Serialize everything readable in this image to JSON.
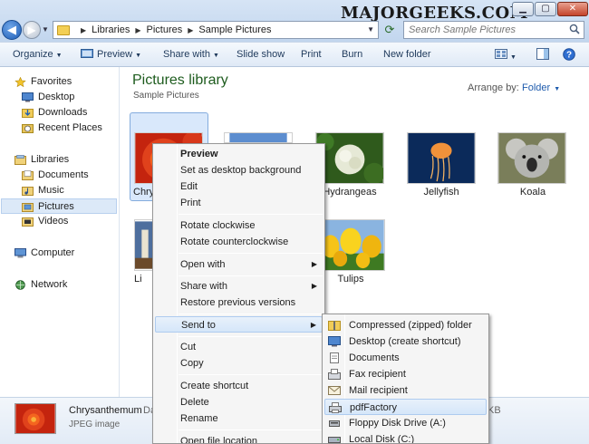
{
  "watermark": "MAJORGEEKS.COM",
  "address": {
    "crumbs": [
      "Libraries",
      "Pictures",
      "Sample Pictures"
    ]
  },
  "search": {
    "placeholder": "Search Sample Pictures"
  },
  "toolbar": {
    "organize": "Organize",
    "preview": "Preview",
    "share_with": "Share with",
    "slide_show": "Slide show",
    "print": "Print",
    "burn": "Burn",
    "new_folder": "New folder"
  },
  "sidebar": {
    "favorites": "Favorites",
    "desktop": "Desktop",
    "downloads": "Downloads",
    "recent_places": "Recent Places",
    "libraries": "Libraries",
    "documents": "Documents",
    "music": "Music",
    "pictures": "Pictures",
    "videos": "Videos",
    "computer": "Computer",
    "network": "Network"
  },
  "main": {
    "title": "Pictures library",
    "subtitle": "Sample Pictures",
    "arrange_label": "Arrange by:",
    "arrange_value": "Folder",
    "files": {
      "chrysanthemum_partial": "Chry",
      "hydrangeas": "Hydrangeas",
      "jellyfish": "Jellyfish",
      "koala": "Koala",
      "lighthouse_partial": "Li",
      "tulips": "Tulips"
    }
  },
  "details": {
    "name": "Chrysanthemum",
    "type": "JPEG image",
    "frag_left": "Da",
    "frag_right": "KB"
  },
  "context_menu": {
    "preview": "Preview",
    "set_desktop_bg": "Set as desktop background",
    "edit": "Edit",
    "print": "Print",
    "rotate_cw": "Rotate clockwise",
    "rotate_ccw": "Rotate counterclockwise",
    "open_with": "Open with",
    "share_with": "Share with",
    "restore_prev": "Restore previous versions",
    "send_to": "Send to",
    "cut": "Cut",
    "copy": "Copy",
    "create_shortcut": "Create shortcut",
    "delete": "Delete",
    "rename": "Rename",
    "open_file_location": "Open file location"
  },
  "send_to_menu": {
    "compressed": "Compressed (zipped) folder",
    "desktop_shortcut": "Desktop (create shortcut)",
    "documents": "Documents",
    "fax": "Fax recipient",
    "mail": "Mail recipient",
    "pdffactory": "pdfFactory",
    "floppy": "Floppy Disk Drive (A:)",
    "local_disk": "Local Disk (C:)"
  }
}
